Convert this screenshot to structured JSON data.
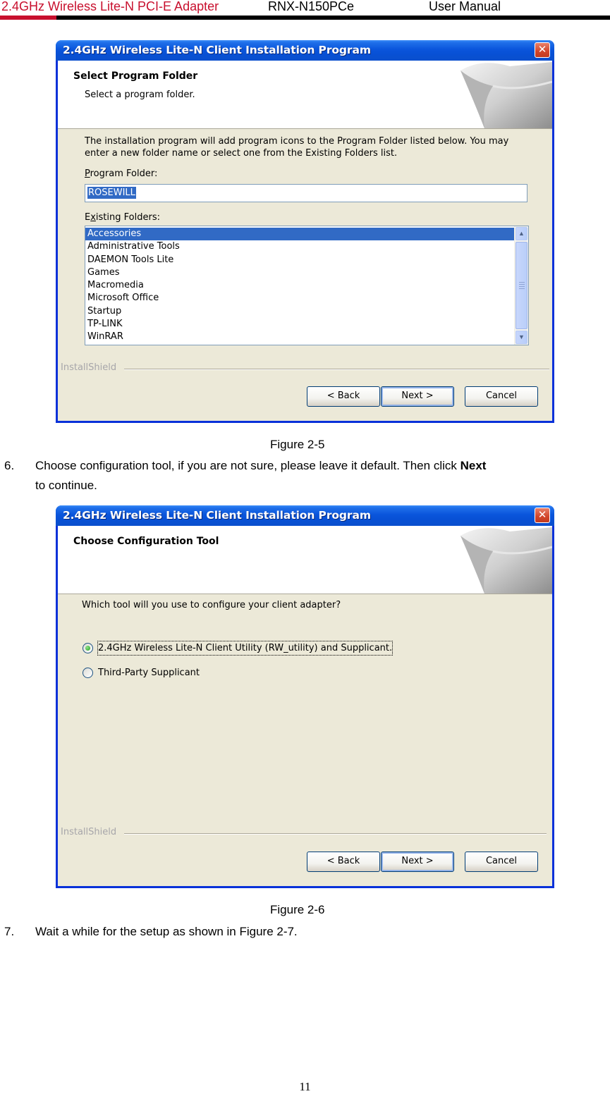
{
  "header": {
    "product": "2.4GHz Wireless Lite-N PCI-E Adapter",
    "model": "RNX-N150PCe",
    "manual": "User Manual"
  },
  "colors": {
    "header_red": "#c8102e",
    "xp_blue": "#0a55dc",
    "selection": "#316ac5"
  },
  "dialog1": {
    "title": "2.4GHz Wireless Lite-N Client Installation Program",
    "heading": "Select Program Folder",
    "subheading": "Select a program folder.",
    "description_line1": "The installation program will add program icons to the Program Folder listed below. You may",
    "description_line2": "enter a new folder name or select one from the Existing Folders list.",
    "program_folder_label_u": "P",
    "program_folder_label_rest": "rogram Folder:",
    "program_folder_value": "ROSEWILL",
    "existing_label_pre": "E",
    "existing_label_u": "x",
    "existing_label_rest": "isting Folders:",
    "folders": [
      "Accessories",
      "Administrative Tools",
      "DAEMON Tools Lite",
      "Games",
      "Macromedia",
      "Microsoft Office",
      "Startup",
      "TP-LINK",
      "WinRAR"
    ],
    "selected_folder": "Accessories",
    "installshield": "InstallShield",
    "back_label": "< Back",
    "next_label": "Next >",
    "cancel_label": "Cancel"
  },
  "caption1": "Figure 2-5",
  "step6": {
    "number": "6.",
    "text": "Choose configuration tool, if you are not sure, please leave it default. Then click ",
    "bold": "Next",
    "line2": "to continue."
  },
  "dialog2": {
    "title": "2.4GHz Wireless Lite-N Client Installation Program",
    "heading": "Choose Configuration Tool",
    "question": "Which tool will you use to configure your client adapter?",
    "options": [
      {
        "label": "2.4GHz Wireless Lite-N Client Utility (RW_utility) and Supplicant.",
        "selected": true
      },
      {
        "label": "Third-Party Supplicant",
        "selected": false
      }
    ],
    "installshield": "InstallShield",
    "back_label": "< Back",
    "next_label": "Next >",
    "cancel_label": "Cancel"
  },
  "caption2": "Figure 2-6",
  "step7": {
    "number": "7.",
    "text": "Wait a while for the setup as shown in Figure 2-7."
  },
  "page_number": "11"
}
